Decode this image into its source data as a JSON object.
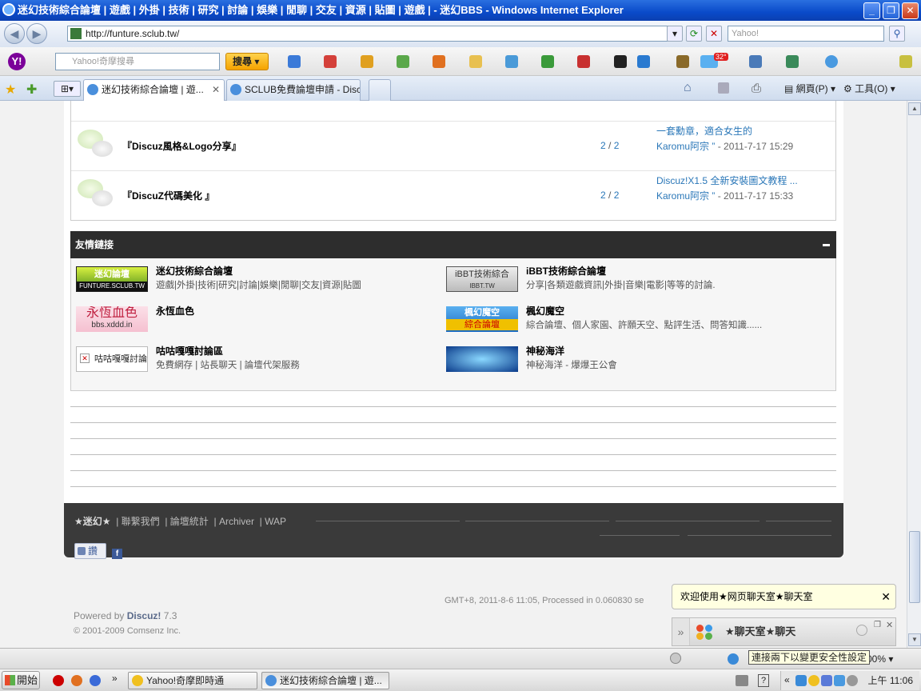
{
  "window": {
    "title": "迷幻技術綜合論壇 | 遊戲 | 外掛 | 技術 | 研究 | 討論 | 娛樂 | 閒聊 | 交友 | 資源 | 貼圖 | 遊戲 | - 迷幻BBS - Windows Internet Explorer"
  },
  "browser": {
    "url": "http://funture.sclub.tw/",
    "search_placeholder": "Yahoo!",
    "yahoo_search_placeholder": "Yahoo!奇摩搜尋",
    "yahoo_search_button": "搜尋",
    "weather_temp": "32°",
    "tabs": [
      {
        "label": "迷幻技術綜合論壇 | 遊...",
        "active": true
      },
      {
        "label": "SCLUB免費論壇申請 - Discuz",
        "active": false
      }
    ],
    "page_menu": "網頁(P)",
    "tools_menu": "工具(O)"
  },
  "forums": [
    {
      "title": "『Discuz風格&Logo分享』",
      "threads": "2",
      "posts": "2",
      "last_post": "一套勳章，適合女生的",
      "last_author": "Karomu阿宗",
      "last_date": "- 2011-7-17 15:29"
    },
    {
      "title": "『DiscuZ代碼美化 』",
      "threads": "2",
      "posts": "2",
      "last_post": "Discuz!X1.5 全新安裝圖文教程 ...",
      "last_author": "Karomu阿宗",
      "last_date": "- 2011-7-17 15:33"
    }
  ],
  "forum_sep": "/",
  "forum_author_suffix": "”",
  "friend_links": {
    "header": "友情鏈接",
    "items": [
      {
        "name": "迷幻技術綜合論壇",
        "desc": "遊戲|外掛|技術|研究|討論|娛樂|閒聊|交友|資源|貼圖",
        "logo_text": "迷幻論壇",
        "logo_sub": "FUNTURE.SCLUB.TW"
      },
      {
        "name": "iBBT技術綜合論壇",
        "desc": "分享|各類遊戲資訊|外掛|音樂|電影|等等的討論.",
        "logo_text": "iBBT技術綜合",
        "logo_sub": "IBBT.TW"
      },
      {
        "name": "永恆血色",
        "desc": "",
        "logo_text": "永恆血色",
        "logo_sub": "bbs.xddd.in"
      },
      {
        "name": "楓幻魔空",
        "desc": "綜合論壇、個人家園、許願天空、點評生活、問答知識......",
        "logo_text": "楓幻魔空",
        "logo_sub": "綜合論壇"
      },
      {
        "name": "咕咕嘎嘎討論區",
        "desc": "免費網存 | 站長聊天 | 論壇代架服務",
        "logo_text": "咕咕嘎嘎討論區",
        "logo_sub": ""
      },
      {
        "name": "神秘海洋",
        "desc": "神秘海洋 - 爆爆王公會",
        "logo_text": "",
        "logo_sub": ""
      }
    ]
  },
  "footer": {
    "brand": "★迷幻★",
    "links": [
      "聯繫我們",
      "論壇統計",
      "Archiver",
      "WAP"
    ],
    "like": "讚",
    "fb": "f",
    "gmt": "GMT+8, 2011-8-6 11:05, Processed in 0.060830 se",
    "powered_prefix": "Powered by",
    "powered_brand": "Discuz!",
    "powered_version": "7.3",
    "copyright": "© 2001-2009 Comsenz Inc."
  },
  "chat": {
    "popup": "欢迎使用★网页聊天室★聊天室",
    "title": "★聊天室★聊天"
  },
  "status": {
    "tooltip": "連接兩下以變更安全性設定",
    "zoom": "00%"
  },
  "taskbar": {
    "start": "開始",
    "tasks": [
      "Yahoo!奇摩即時通",
      "迷幻技術綜合論壇 | 遊..."
    ],
    "clock": "上午 11:06"
  },
  "colors": {
    "accent": "#2a77b8",
    "header_dark": "#2d2d2d"
  }
}
